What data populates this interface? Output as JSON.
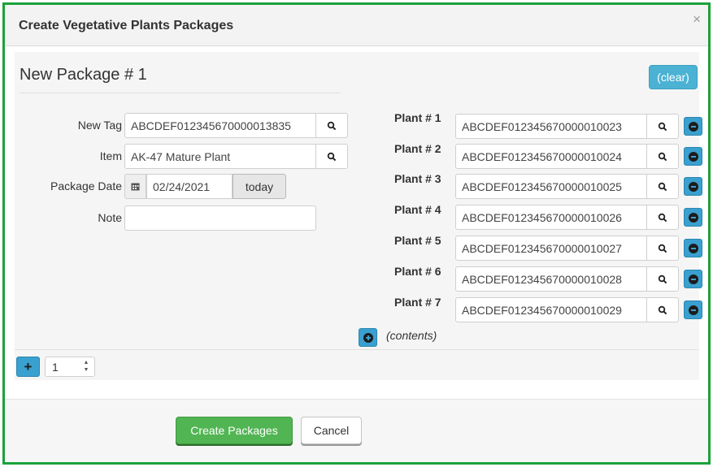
{
  "dialog": {
    "title": "Create Vegetative Plants Packages",
    "close_glyph": "×"
  },
  "package": {
    "title": "New Package # 1",
    "clear_label": "(clear)",
    "new_tag_label": "New Tag",
    "new_tag_value": "ABCDEF012345670000013835",
    "item_label": "Item",
    "item_value": "AK-47 Mature Plant",
    "date_label": "Package Date",
    "date_value": "02/24/2021",
    "today_label": "today",
    "note_label": "Note",
    "note_value": ""
  },
  "plants": [
    {
      "label": "Plant # 1",
      "tag": "ABCDEF012345670000010023"
    },
    {
      "label": "Plant # 2",
      "tag": "ABCDEF012345670000010024"
    },
    {
      "label": "Plant # 3",
      "tag": "ABCDEF012345670000010025"
    },
    {
      "label": "Plant # 4",
      "tag": "ABCDEF012345670000010026"
    },
    {
      "label": "Plant # 5",
      "tag": "ABCDEF012345670000010027"
    },
    {
      "label": "Plant # 6",
      "tag": "ABCDEF012345670000010028"
    },
    {
      "label": "Plant # 7",
      "tag": "ABCDEF012345670000010029"
    }
  ],
  "contents_label": "(contents)",
  "package_count": "1",
  "footer": {
    "create_label": "Create Packages",
    "cancel_label": "Cancel"
  },
  "icons": {
    "search": "search-icon",
    "calendar": "calendar-icon",
    "remove": "minus-circle-icon",
    "add_plant": "plus-circle-icon",
    "add_package": "plus-icon"
  },
  "colors": {
    "frame_border": "#1aa23a",
    "info_button": "#4bb2d3",
    "primary_green": "#52b553",
    "action_blue": "#3aa0cf"
  }
}
